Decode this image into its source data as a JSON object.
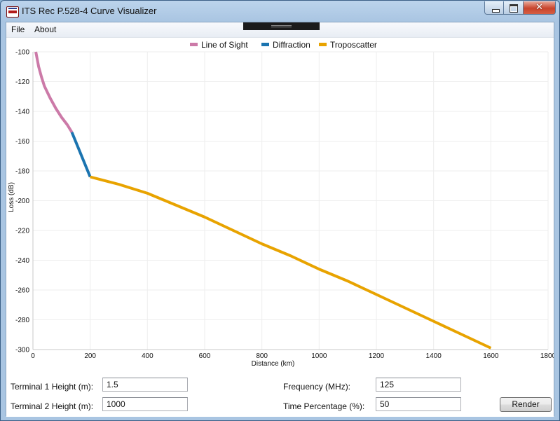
{
  "window": {
    "title": "ITS Rec P.528-4 Curve Visualizer",
    "icon": "its-logo-icon",
    "controls": {
      "minimize": "minimize-icon",
      "maximize": "maximize-icon",
      "close": "✕"
    }
  },
  "menu": {
    "file": "File",
    "about": "About"
  },
  "colors": {
    "line_of_sight": "#cc7aa8",
    "diffraction": "#1b74b0",
    "troposcatter": "#e8a300",
    "grid": "#eeeeee",
    "titlebar": "#a9c5e2"
  },
  "chart_data": {
    "type": "line",
    "xlabel": "Distance (km)",
    "ylabel": "Loss (dB)",
    "xlim": [
      0,
      1800
    ],
    "ylim": [
      -300,
      -100
    ],
    "xticks": [
      "0",
      "200",
      "400",
      "600",
      "800",
      "1000",
      "1200",
      "1400",
      "1600",
      "1800"
    ],
    "yticks": [
      "-100",
      "-120",
      "-140",
      "-160",
      "-180",
      "-200",
      "-220",
      "-240",
      "-260",
      "-280",
      "-300"
    ],
    "grid": true,
    "legend_position": "top-center",
    "series": [
      {
        "name": "Line of Sight",
        "color": "#cc7aa8",
        "x": [
          10,
          15,
          20,
          30,
          40,
          60,
          80,
          100,
          120,
          136
        ],
        "y": [
          -100,
          -105,
          -110,
          -117,
          -123,
          -131,
          -138,
          -144,
          -149,
          -154
        ]
      },
      {
        "name": "Diffraction",
        "color": "#1b74b0",
        "x": [
          136,
          200
        ],
        "y": [
          -154,
          -184
        ]
      },
      {
        "name": "Troposcatter",
        "color": "#e8a300",
        "x": [
          200,
          250,
          300,
          400,
          500,
          600,
          700,
          800,
          900,
          1000,
          1100,
          1200,
          1300,
          1400,
          1500,
          1600
        ],
        "y": [
          -184,
          -186.5,
          -189,
          -195,
          -203,
          -211,
          -220,
          -229,
          -237,
          -246,
          -254,
          -263,
          -272,
          -281,
          -290,
          -299
        ]
      }
    ]
  },
  "form": {
    "terminal1_label": "Terminal 1 Height (m):",
    "terminal1_value": "1.5",
    "terminal2_label": "Terminal 2 Height (m):",
    "terminal2_value": "1000",
    "frequency_label": "Frequency (MHz):",
    "frequency_value": "125",
    "time_label": "Time Percentage (%):",
    "time_value": "50",
    "render_label": "Render"
  }
}
